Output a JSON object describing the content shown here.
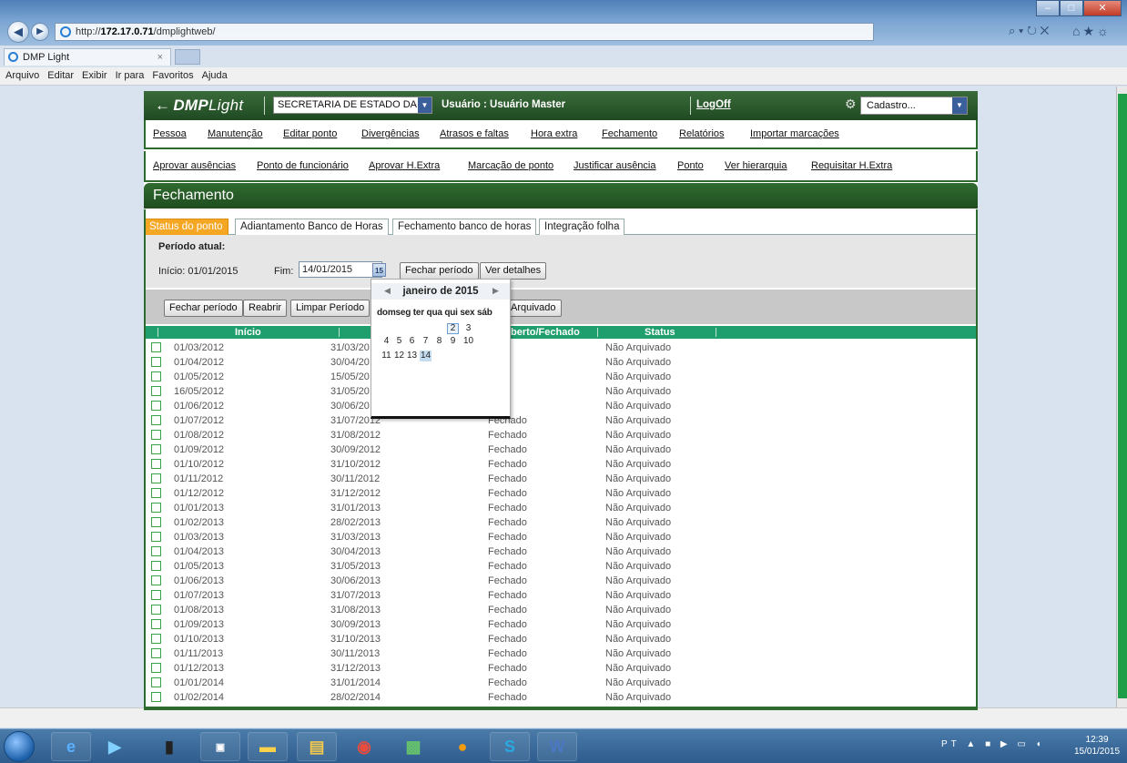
{
  "browser": {
    "url_prefix": "http://",
    "url_host": "172.17.0.71",
    "url_path": "/dmplightweb/",
    "tab_title": "DMP Light",
    "tab_close": "×",
    "addr_tools": "⌕ ▾ ↻ ✕",
    "right_icons": "⌂★☼",
    "menu": [
      "Arquivo",
      "Editar",
      "Exibir",
      "Ir para",
      "Favoritos",
      "Ajuda"
    ]
  },
  "header": {
    "logo_bold": "DMP",
    "logo_light": "Light",
    "org_select": "SECRETARIA DE ESTADO DA SAU",
    "user_label": "Usuário : Usuário Master",
    "logoff": "LogOff",
    "cadastro_select": "Cadastro..."
  },
  "nav1": [
    "Pessoa",
    "Manutenção",
    "Editar ponto",
    "Divergências",
    "Atrasos e faltas",
    "Hora extra",
    "Fechamento",
    "Relatórios",
    "Importar marcações"
  ],
  "nav2": [
    "Aprovar ausências",
    "Ponto de funcionário",
    "Aprovar H.Extra",
    "Marcação de ponto",
    "Justificar ausência",
    "Ponto",
    "Ver hierarquia",
    "Requisitar H.Extra"
  ],
  "section_title": "Fechamento",
  "tabs": [
    "Status do ponto",
    "Adiantamento Banco de Horas",
    "Fechamento banco de horas",
    "Integração folha"
  ],
  "periodo": {
    "label": "Período atual:",
    "inicio": "Início: 01/01/2015",
    "fim_label": "Fim:",
    "fim_value": "14/01/2015",
    "cal_icon": "15",
    "fechar_periodo": "Fechar período",
    "ver_detalhes": "Ver detalhes"
  },
  "actions": {
    "fechar_periodo": "Fechar período",
    "reabrir": "Reabrir",
    "limpar_periodo": "Limpar Período",
    "arquivado": "Arquivado"
  },
  "table": {
    "headers": [
      "Início",
      "berto/Fechado",
      "Status"
    ],
    "rows": [
      [
        "01/03/2012",
        "31/03/20",
        "ado",
        "Não Arquivado"
      ],
      [
        "01/04/2012",
        "30/04/20",
        "ado",
        "Não Arquivado"
      ],
      [
        "01/05/2012",
        "15/05/20",
        "ado",
        "Não Arquivado"
      ],
      [
        "16/05/2012",
        "31/05/20",
        "ado",
        "Não Arquivado"
      ],
      [
        "01/06/2012",
        "30/06/20",
        "ado",
        "Não Arquivado"
      ],
      [
        "01/07/2012",
        "31/07/2012",
        "Fechado",
        "Não Arquivado"
      ],
      [
        "01/08/2012",
        "31/08/2012",
        "Fechado",
        "Não Arquivado"
      ],
      [
        "01/09/2012",
        "30/09/2012",
        "Fechado",
        "Não Arquivado"
      ],
      [
        "01/10/2012",
        "31/10/2012",
        "Fechado",
        "Não Arquivado"
      ],
      [
        "01/11/2012",
        "30/11/2012",
        "Fechado",
        "Não Arquivado"
      ],
      [
        "01/12/2012",
        "31/12/2012",
        "Fechado",
        "Não Arquivado"
      ],
      [
        "01/01/2013",
        "31/01/2013",
        "Fechado",
        "Não Arquivado"
      ],
      [
        "01/02/2013",
        "28/02/2013",
        "Fechado",
        "Não Arquivado"
      ],
      [
        "01/03/2013",
        "31/03/2013",
        "Fechado",
        "Não Arquivado"
      ],
      [
        "01/04/2013",
        "30/04/2013",
        "Fechado",
        "Não Arquivado"
      ],
      [
        "01/05/2013",
        "31/05/2013",
        "Fechado",
        "Não Arquivado"
      ],
      [
        "01/06/2013",
        "30/06/2013",
        "Fechado",
        "Não Arquivado"
      ],
      [
        "01/07/2013",
        "31/07/2013",
        "Fechado",
        "Não Arquivado"
      ],
      [
        "01/08/2013",
        "31/08/2013",
        "Fechado",
        "Não Arquivado"
      ],
      [
        "01/09/2013",
        "30/09/2013",
        "Fechado",
        "Não Arquivado"
      ],
      [
        "01/10/2013",
        "31/10/2013",
        "Fechado",
        "Não Arquivado"
      ],
      [
        "01/11/2013",
        "30/11/2013",
        "Fechado",
        "Não Arquivado"
      ],
      [
        "01/12/2013",
        "31/12/2013",
        "Fechado",
        "Não Arquivado"
      ],
      [
        "01/01/2014",
        "31/01/2014",
        "Fechado",
        "Não Arquivado"
      ],
      [
        "01/02/2014",
        "28/02/2014",
        "Fechado",
        "Não Arquivado"
      ]
    ]
  },
  "calendar": {
    "month_label": "janeiro de 2015",
    "prev": "◀",
    "next": "▶",
    "dow": [
      "dom",
      "seg",
      "ter",
      "qua",
      "qui",
      "sex",
      "sáb"
    ],
    "days": [
      "2",
      "3",
      "4",
      "5",
      "6",
      "7",
      "8",
      "9",
      "10",
      "11",
      "12",
      "13",
      "14"
    ],
    "selected_day": "2",
    "today_day": "14"
  },
  "taskbar": {
    "lang": "PT",
    "time": "12:39",
    "date": "15/01/2015",
    "apps": [
      "ie-icon",
      "media-icon",
      "battery-icon",
      "terminal-3270-icon",
      "folder-icon",
      "explorer-icon",
      "chrome-icon",
      "shield-icon",
      "firefox-icon",
      "skype-icon",
      "word-icon"
    ]
  },
  "colors": {
    "app_green": "#1f4a22",
    "table_header": "#1f9e6e",
    "tab_active": "#f5a623"
  }
}
